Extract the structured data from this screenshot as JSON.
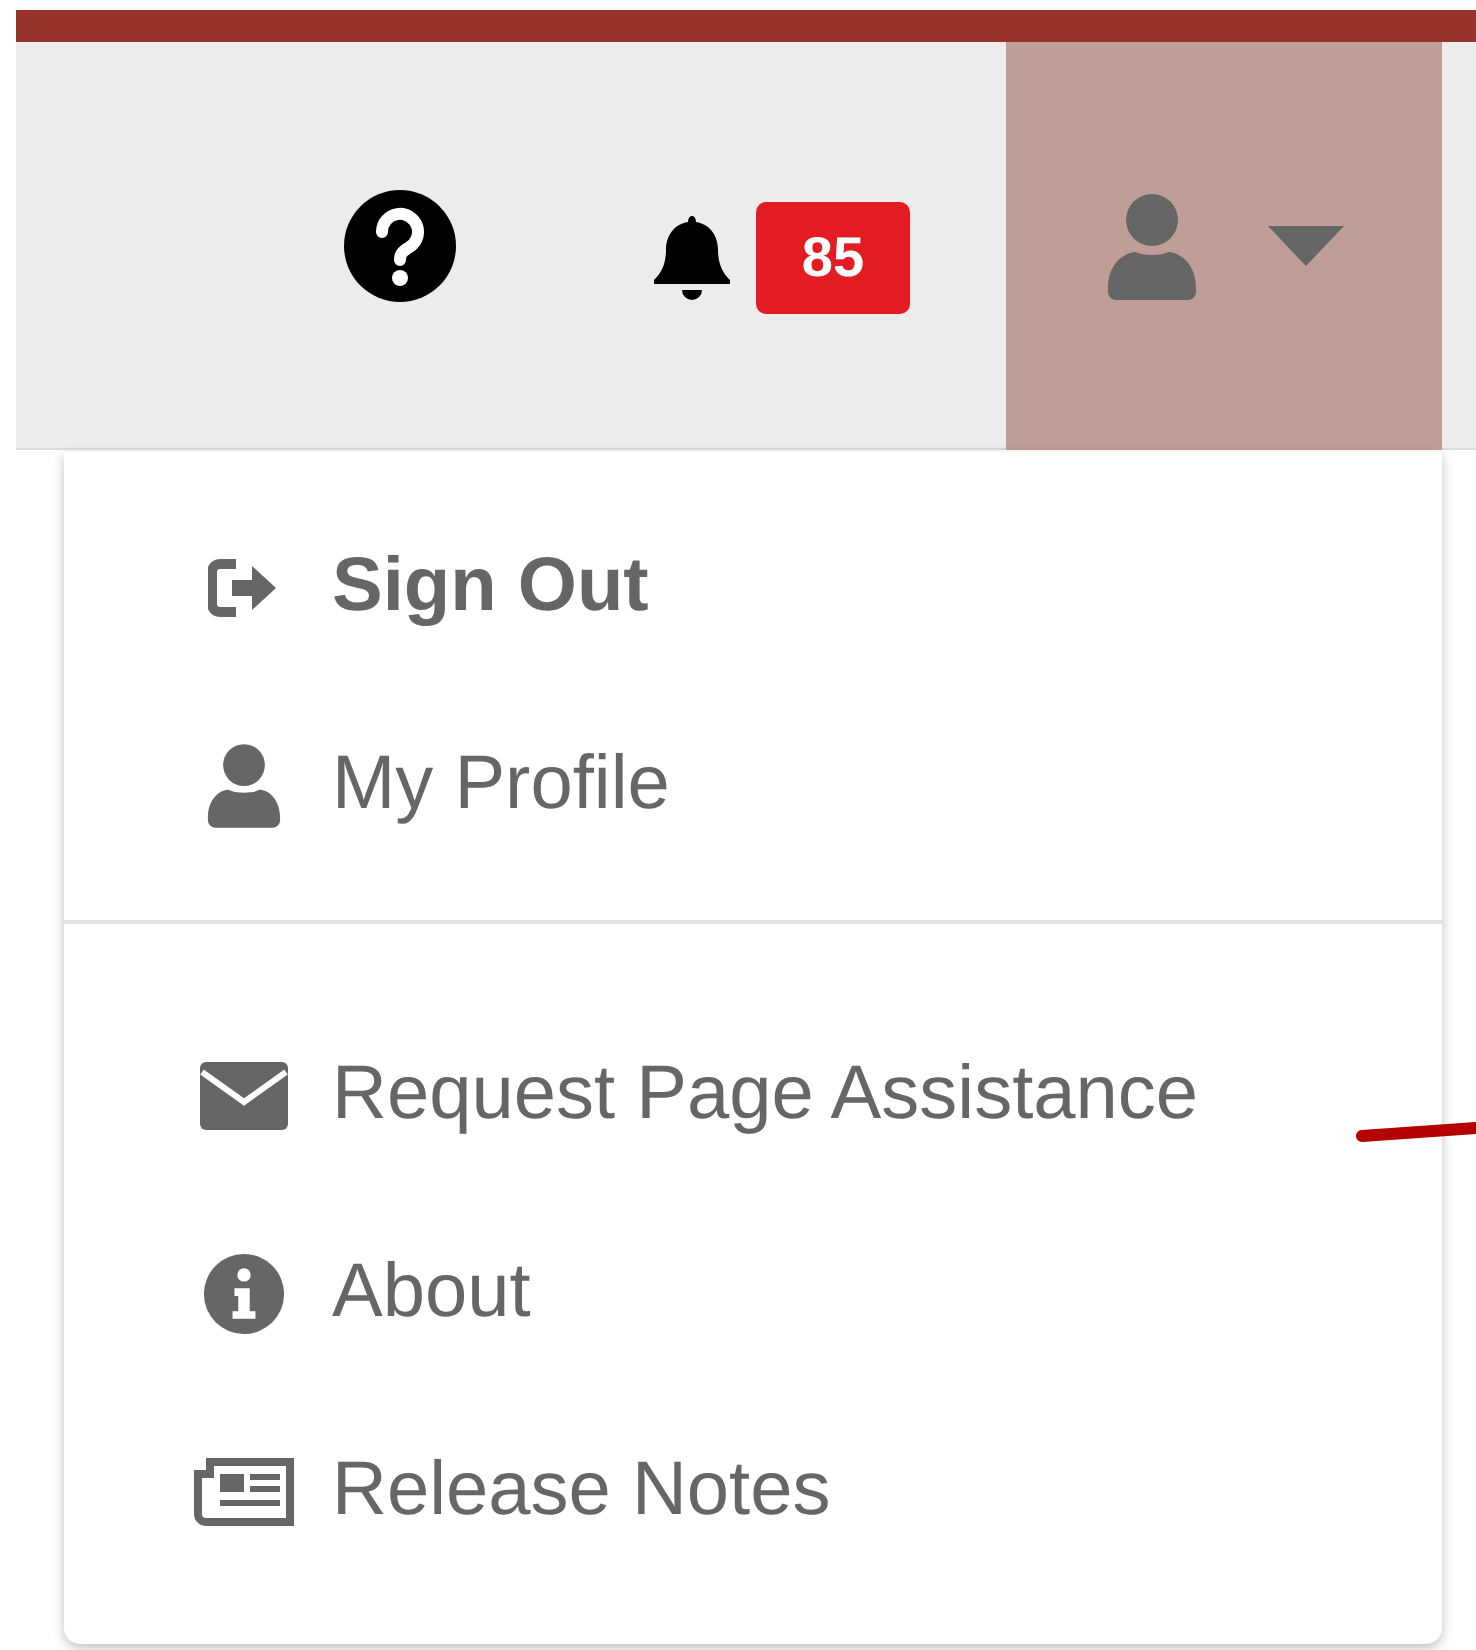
{
  "header": {
    "notifications": {
      "count": "85"
    },
    "user_menu": {
      "expanded": true
    }
  },
  "menu_groups": [
    [
      {
        "kind": "sign-out",
        "label": "Sign Out",
        "bold": true
      },
      {
        "kind": "user",
        "label": "My Profile",
        "bold": false
      }
    ],
    [
      {
        "kind": "mail",
        "label": "Request Page Assistance",
        "bold": false
      },
      {
        "kind": "info",
        "label": "About",
        "bold": false
      },
      {
        "kind": "news",
        "label": "Release Notes",
        "bold": false
      }
    ]
  ]
}
